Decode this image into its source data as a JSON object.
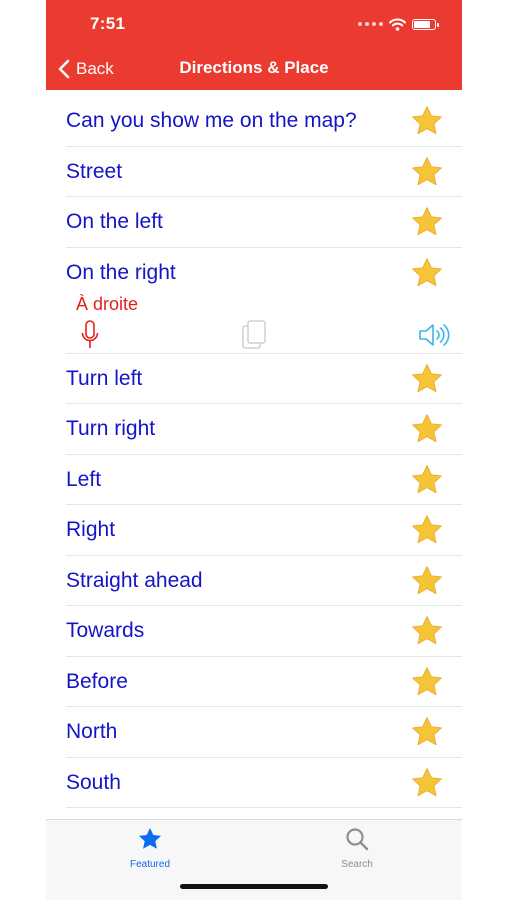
{
  "status": {
    "time": "7:51"
  },
  "nav": {
    "back_label": "Back",
    "title": "Directions & Place"
  },
  "colors": {
    "header": "#EB3A2F",
    "phrase": "#1414C8",
    "translation": "#E3221A",
    "star": "#F6C437",
    "speaker": "#3BB6E8",
    "tab_active": "#0A6CF0",
    "tab_inactive": "#8E8E93"
  },
  "phrases": [
    {
      "text": "Can you show me on the map?"
    },
    {
      "text": "Street"
    },
    {
      "text": "On the left"
    },
    {
      "text": "On the right",
      "translation": "À droite"
    },
    {
      "text": "Turn left"
    },
    {
      "text": "Turn right"
    },
    {
      "text": "Left"
    },
    {
      "text": "Right"
    },
    {
      "text": "Straight ahead"
    },
    {
      "text": "Towards"
    },
    {
      "text": "Before"
    },
    {
      "text": "North"
    },
    {
      "text": "South"
    }
  ],
  "expanded_actions": {
    "icons": [
      "microphone-icon",
      "copy-icon",
      "speaker-icon"
    ]
  },
  "tabs": [
    {
      "label": "Featured",
      "icon": "star-icon",
      "active": true
    },
    {
      "label": "Search",
      "icon": "magnifier-icon",
      "active": false
    }
  ]
}
